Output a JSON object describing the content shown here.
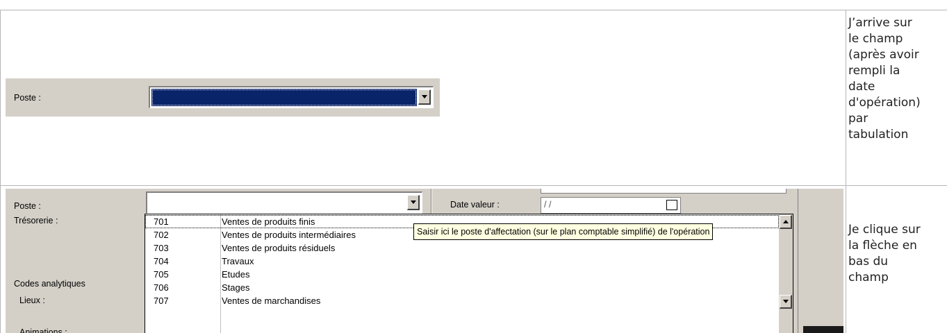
{
  "rows": [
    {
      "description_lines": [
        "J’arrive sur",
        "le champ",
        "(après avoir",
        "rempli la",
        "date",
        "d'opération)",
        "par",
        "tabulation"
      ],
      "screenshot": {
        "poste_label": "Poste :",
        "field_state": "focused-selected"
      }
    },
    {
      "description_lines": [
        "Je clique sur",
        "la flèche en",
        "bas du",
        "champ"
      ],
      "screenshot": {
        "labels": {
          "poste": "Poste :",
          "tresorerie": "Trésorerie :",
          "codes_analytiques": "Codes analytiques",
          "lieux": "Lieux :",
          "animations": "Animations :",
          "date_valeur": "Date valeur :"
        },
        "date_placeholder": "/ /",
        "dropdown_items": [
          {
            "code": "701",
            "name": "Ventes de produits finis"
          },
          {
            "code": "702",
            "name": "Ventes de produits intermédiaires"
          },
          {
            "code": "703",
            "name": "Ventes de produits résiduels"
          },
          {
            "code": "704",
            "name": "Travaux"
          },
          {
            "code": "705",
            "name": "Etudes"
          },
          {
            "code": "706",
            "name": "Stages"
          },
          {
            "code": "707",
            "name": "Ventes de marchandises"
          }
        ],
        "tooltip": "Saisir ici le poste d'affectation (sur le plan comptable simplifié) de l'opération"
      }
    }
  ],
  "colors": {
    "window_face": "#d4d0c8",
    "selection": "#0a246a",
    "tooltip_bg": "#ffffe1",
    "table_border": "#b5b5b5"
  }
}
